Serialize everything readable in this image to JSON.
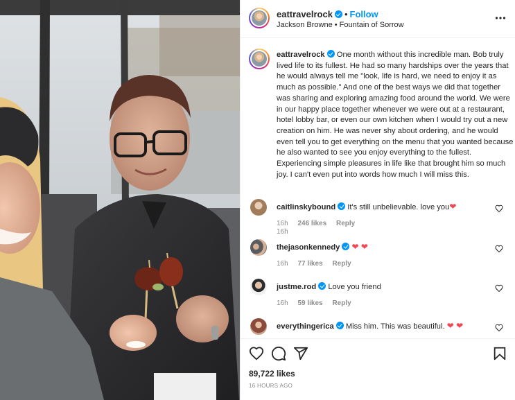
{
  "post": {
    "username": "eattravelrock",
    "follow_label": "Follow",
    "dot": "•",
    "audio": "Jackson Browne • Fountain of Sorrow",
    "more_icon": "more-horizontal-icon"
  },
  "caption": {
    "username": "eattravelrock",
    "text": "One month without this incredible man. Bob truly lived life to its fullest. He had so many hardships over the years that he would always tell me \"look, life is hard, we need to enjoy it as much as possible.\" And one of the best ways we did that together was sharing and exploring amazing food around the world. We were in our happy place together whenever we were out at a restaurant, hotel lobby bar, or even our own kitchen when I would try out a new creation on him. He was never shy about ordering, and he would even tell you to get everything on the menu that you wanted because he also wanted to see you enjoy everything to the fullest. Experiencing simple pleasures in life like that brought him so much joy. I can't even put into words how much I will miss this.",
    "time": "16h"
  },
  "comments": [
    {
      "username": "caitlinskybound",
      "text": "It's still unbelievable. love you",
      "emoji": "❤",
      "time": "16h",
      "likes": "246 likes",
      "reply": "Reply"
    },
    {
      "username": "thejasonkennedy",
      "text": "",
      "emoji": "❤ ❤",
      "time": "16h",
      "likes": "77 likes",
      "reply": "Reply"
    },
    {
      "username": "justme.rod",
      "text": "Love you friend",
      "emoji": "",
      "time": "16h",
      "likes": "59 likes",
      "reply": "Reply"
    },
    {
      "username": "everythingerica",
      "text": "Miss him. This was beautiful.",
      "emoji": "❤ ❤",
      "time": "",
      "likes": "",
      "reply": ""
    }
  ],
  "actions": {
    "likes": "89,722 likes",
    "time": "16 HOURS AGO",
    "icons": [
      "heart-icon",
      "comment-icon",
      "share-icon",
      "bookmark-icon"
    ]
  },
  "colors": {
    "accent": "#0095f6",
    "heart": "#ed4956",
    "text": "#262626",
    "muted": "#8e8e8e"
  }
}
